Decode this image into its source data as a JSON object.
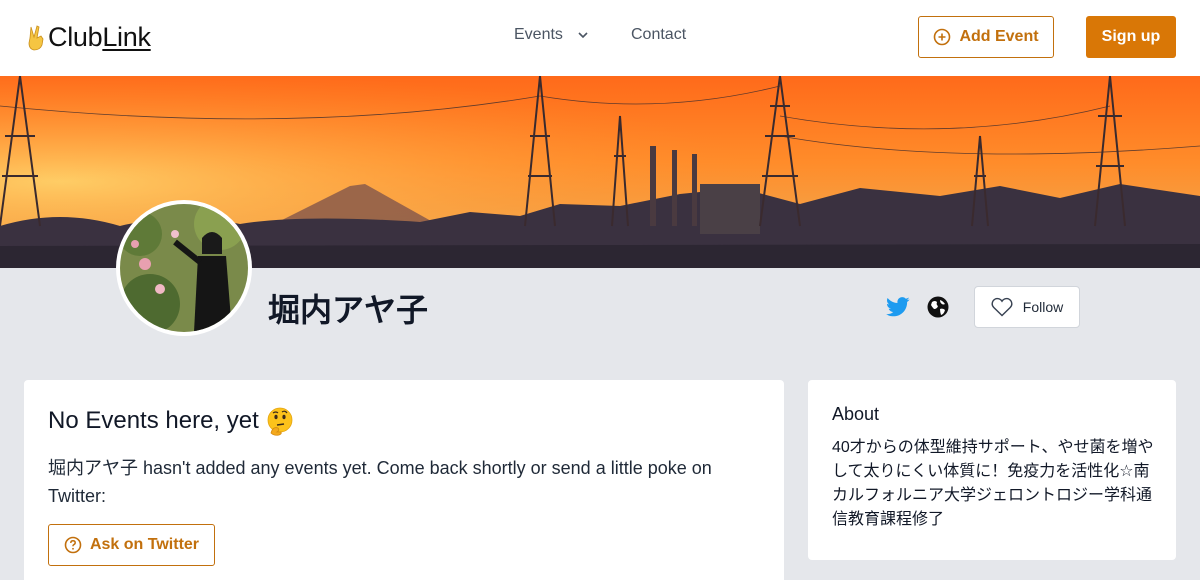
{
  "header": {
    "logo_prefix": "Club",
    "logo_suffix": "Link",
    "nav_events": "Events",
    "nav_contact": "Contact",
    "add_event": "Add Event",
    "sign_up": "Sign up"
  },
  "profile": {
    "name": "堀内アヤ子",
    "follow_label": "Follow"
  },
  "events_card": {
    "title": "No Events here, yet",
    "description": "堀内アヤ子 hasn't added any events yet. Come back shortly or send a little poke on Twitter:",
    "ask_button": "Ask on Twitter"
  },
  "about_card": {
    "title": "About",
    "text": "40才からの体型維持サポート、やせ菌を増やして太りにくい体質に！免疫力を活性化☆南カルフォルニア大学ジェロントロジー学科通信教育課程修了"
  },
  "colors": {
    "accent": "#d97706",
    "accent_border": "#c2700d",
    "twitter": "#1d9bf0",
    "page_bg": "#e5e7eb"
  },
  "icons": [
    "peace-hand-icon",
    "chevron-down-icon",
    "plus-circle-icon",
    "twitter-icon",
    "globe-icon",
    "heart-icon",
    "thinking-face-icon",
    "question-circle-icon"
  ]
}
